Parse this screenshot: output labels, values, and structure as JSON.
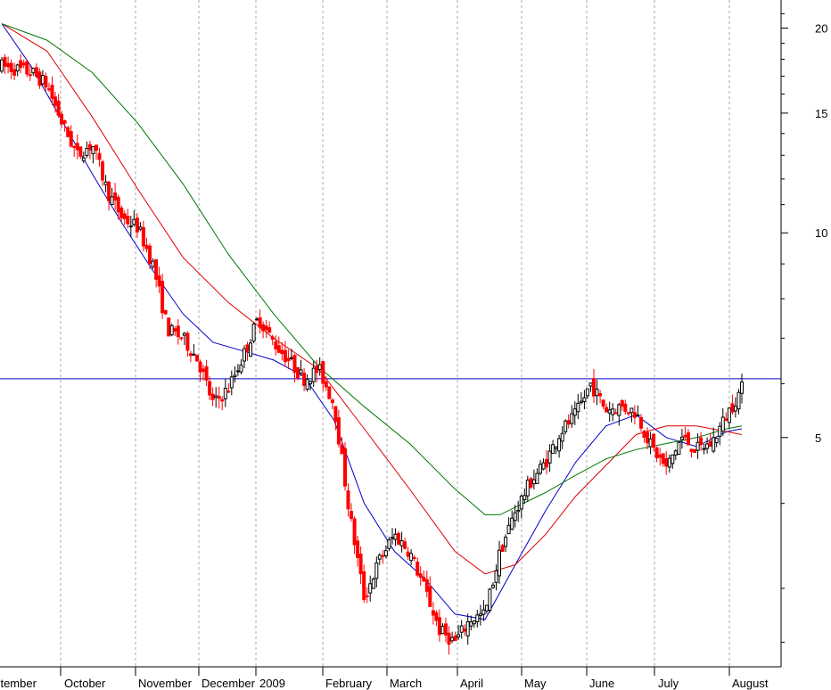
{
  "chart_data": {
    "type": "candlestick",
    "title": "",
    "xlabel": "",
    "ylabel": "",
    "scale": "log",
    "ylim": [
      2.3,
      22
    ],
    "grid": "vertical dashed month separators",
    "x_tick_labels": [
      "eptember",
      "October",
      "November",
      "December",
      "2009",
      "February",
      "March",
      "April",
      "May",
      "June",
      "July",
      "August"
    ],
    "y_tick_labels": [
      "20",
      "15",
      "10",
      "5"
    ],
    "y_tick_values": [
      20,
      15,
      10,
      5
    ],
    "horizontal_line": 6.1,
    "colors": {
      "up_candle": "#000000",
      "down_candle": "#ff0000",
      "ma_short": "#0000cc",
      "ma_mid": "#dd0000",
      "ma_long": "#007700",
      "hline": "#0000cc",
      "grid": "#aaaaaa"
    },
    "series": [
      {
        "kind": "price_anchors",
        "points": [
          [
            0,
            17.6
          ],
          [
            1,
            17.4
          ],
          [
            2,
            17.2
          ],
          [
            3,
            16.5
          ],
          [
            4,
            14.5
          ],
          [
            5,
            13.0
          ],
          [
            6,
            13.5
          ],
          [
            7,
            11.5
          ],
          [
            8,
            10.5
          ],
          [
            9,
            10.2
          ],
          [
            10,
            9.0
          ],
          [
            11,
            7.2
          ],
          [
            12,
            7.0
          ],
          [
            13,
            6.5
          ],
          [
            14,
            5.6
          ],
          [
            15,
            5.9
          ],
          [
            16,
            6.6
          ],
          [
            17,
            7.5
          ],
          [
            18,
            6.9
          ],
          [
            19,
            6.5
          ],
          [
            20,
            6.1
          ],
          [
            21,
            6.3
          ],
          [
            22,
            5.6
          ],
          [
            23,
            3.9
          ],
          [
            24,
            2.9
          ],
          [
            25,
            3.3
          ],
          [
            26,
            3.6
          ],
          [
            27,
            3.4
          ],
          [
            28,
            3.0
          ],
          [
            29,
            2.6
          ],
          [
            30,
            2.5
          ],
          [
            31,
            2.7
          ],
          [
            32,
            2.75
          ],
          [
            33,
            3.4
          ],
          [
            34,
            3.9
          ],
          [
            35,
            4.3
          ],
          [
            36,
            4.6
          ],
          [
            37,
            5.1
          ],
          [
            38,
            5.4
          ],
          [
            39,
            6.0
          ],
          [
            40,
            5.5
          ],
          [
            41,
            5.55
          ],
          [
            42,
            5.45
          ],
          [
            43,
            4.85
          ],
          [
            44,
            4.5
          ],
          [
            45,
            5.0
          ],
          [
            46,
            4.8
          ],
          [
            47,
            4.9
          ],
          [
            48,
            5.4
          ],
          [
            49,
            5.9
          ]
        ]
      },
      {
        "kind": "moving_average",
        "name": "",
        "points": [
          [
            0,
            20.3
          ],
          [
            2,
            17.5
          ],
          [
            4,
            14.6
          ],
          [
            6,
            12.2
          ],
          [
            8,
            10.3
          ],
          [
            10,
            8.8
          ],
          [
            12,
            7.6
          ],
          [
            14,
            6.9
          ],
          [
            16,
            6.7
          ],
          [
            18,
            6.5
          ],
          [
            20,
            6.15
          ],
          [
            22,
            5.3
          ],
          [
            24,
            4.0
          ],
          [
            26,
            3.4
          ],
          [
            28,
            3.1
          ],
          [
            30,
            2.75
          ],
          [
            32,
            2.7
          ],
          [
            34,
            3.25
          ],
          [
            36,
            3.9
          ],
          [
            38,
            4.6
          ],
          [
            40,
            5.2
          ],
          [
            42,
            5.4
          ],
          [
            44,
            5.0
          ],
          [
            46,
            4.85
          ],
          [
            48,
            5.1
          ],
          [
            49,
            5.15
          ]
        ]
      },
      {
        "kind": "moving_average",
        "name": "",
        "points": [
          [
            0,
            20.3
          ],
          [
            3,
            18.5
          ],
          [
            6,
            14.8
          ],
          [
            9,
            11.6
          ],
          [
            12,
            9.2
          ],
          [
            15,
            7.9
          ],
          [
            18,
            7.0
          ],
          [
            21,
            6.3
          ],
          [
            24,
            5.15
          ],
          [
            27,
            4.2
          ],
          [
            30,
            3.4
          ],
          [
            32,
            3.15
          ],
          [
            34,
            3.25
          ],
          [
            36,
            3.6
          ],
          [
            38,
            4.1
          ],
          [
            40,
            4.55
          ],
          [
            42,
            5.05
          ],
          [
            44,
            5.2
          ],
          [
            46,
            5.2
          ],
          [
            48,
            5.1
          ],
          [
            49,
            5.05
          ]
        ]
      },
      {
        "kind": "moving_average",
        "name": "",
        "points": [
          [
            0,
            20.3
          ],
          [
            3,
            19.2
          ],
          [
            6,
            17.2
          ],
          [
            9,
            14.5
          ],
          [
            12,
            11.8
          ],
          [
            15,
            9.3
          ],
          [
            18,
            7.6
          ],
          [
            21,
            6.35
          ],
          [
            24,
            5.55
          ],
          [
            27,
            4.9
          ],
          [
            30,
            4.2
          ],
          [
            32,
            3.85
          ],
          [
            33,
            3.85
          ],
          [
            34,
            3.95
          ],
          [
            36,
            4.15
          ],
          [
            38,
            4.4
          ],
          [
            40,
            4.65
          ],
          [
            42,
            4.8
          ],
          [
            44,
            4.9
          ],
          [
            46,
            5.0
          ],
          [
            48,
            5.15
          ],
          [
            49,
            5.2
          ]
        ]
      }
    ]
  }
}
